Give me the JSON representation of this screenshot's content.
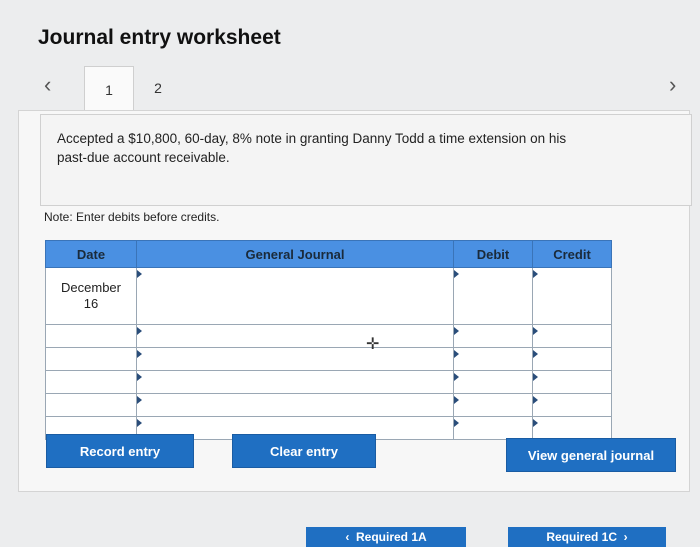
{
  "page": {
    "title": "Journal entry worksheet"
  },
  "nav": {
    "prev_icon": "chevron-left-icon",
    "next_icon": "chevron-right-icon",
    "tabs": [
      {
        "label": "1"
      },
      {
        "label": "2"
      }
    ]
  },
  "scenario": {
    "text": "Accepted a $10,800, 60-day, 8% note in granting Danny Todd a time extension on his past-due account receivable."
  },
  "note": "Note: Enter debits before credits.",
  "table": {
    "headers": {
      "date": "Date",
      "journal": "General Journal",
      "debit": "Debit",
      "credit": "Credit"
    },
    "date_month": "December",
    "date_day": "16",
    "row_count": 6
  },
  "buttons": {
    "record": "Record entry",
    "clear": "Clear entry",
    "view": "View general journal"
  },
  "footer": {
    "prev": "Required 1A",
    "next": "Required 1C"
  },
  "colors": {
    "accent": "#1f6fc2",
    "header": "#4a90e2"
  }
}
